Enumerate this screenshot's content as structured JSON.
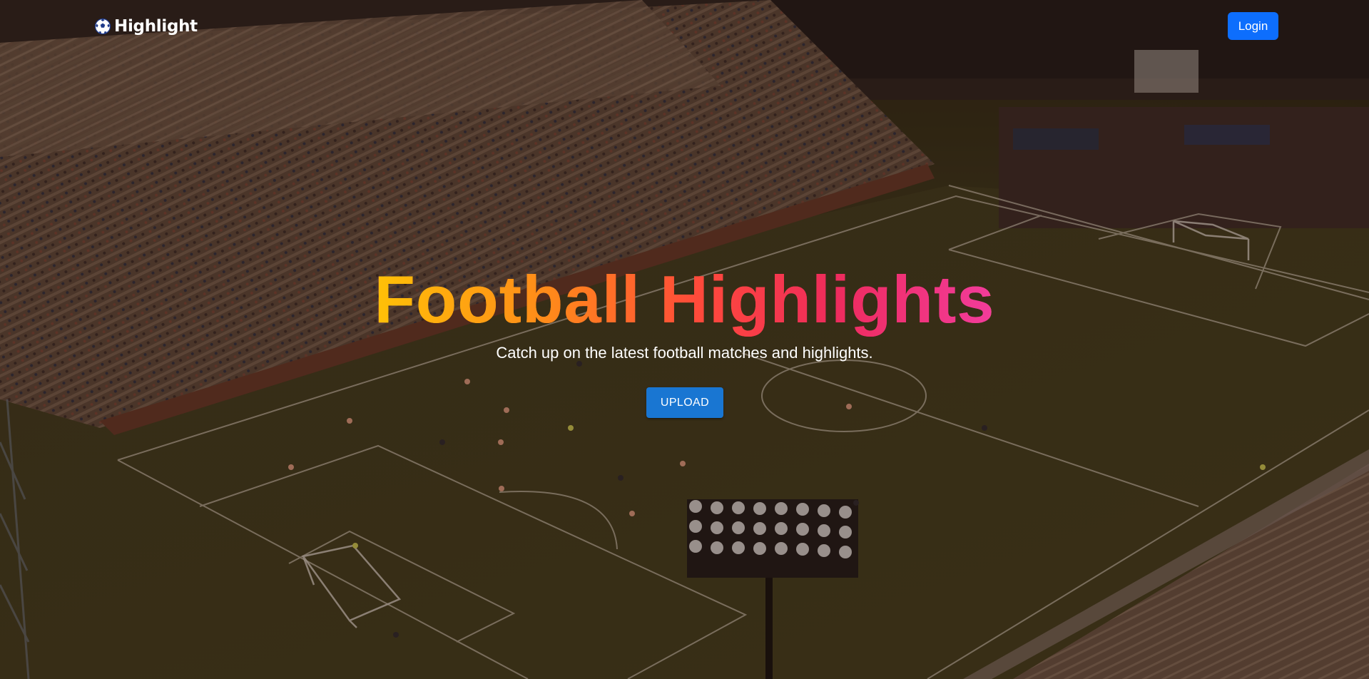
{
  "navbar": {
    "brand_name": "Highlight",
    "brand_icon": "soccer-ball-icon",
    "login_label": "Login"
  },
  "hero": {
    "title": "Football Highlights",
    "subtitle": "Catch up on the latest football matches and highlights.",
    "upload_label": "UPLOAD"
  },
  "colors": {
    "primary_button": "#0d6efd",
    "upload_button": "#1976d2",
    "title_gradient": [
      "#ffc107",
      "#ff8a1a",
      "#ff4a3a",
      "#ee2b5c",
      "#f23c9c"
    ]
  }
}
